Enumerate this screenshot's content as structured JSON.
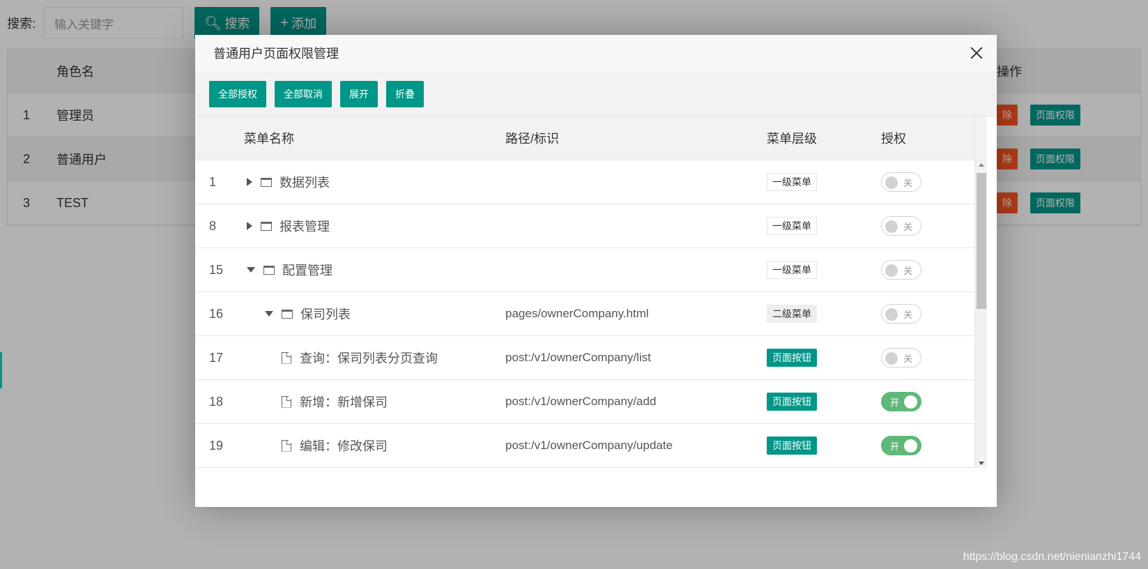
{
  "background": {
    "search_label": "搜索:",
    "search_placeholder": "输入关键字",
    "search_button": "搜索",
    "add_button": "添加",
    "table": {
      "headers": {
        "name": "角色名",
        "op": "操作"
      },
      "rows": [
        {
          "num": "1",
          "name": "管理员",
          "del": "除",
          "perm": "页面权限"
        },
        {
          "num": "2",
          "name": "普通用户",
          "del": "除",
          "perm": "页面权限"
        },
        {
          "num": "3",
          "name": "TEST",
          "del": "除",
          "perm": "页面权限"
        }
      ]
    },
    "watermark": "https://blog.csdn.net/nienianzhi1744"
  },
  "modal": {
    "title": "普通用户页面权限管理",
    "toolbar": {
      "grant_all": "全部授权",
      "cancel_all": "全部取消",
      "expand": "展开",
      "collapse": "折叠"
    },
    "headers": {
      "name": "菜单名称",
      "path": "路径/标识",
      "level": "菜单层级",
      "auth": "授权"
    },
    "rows": [
      {
        "num": "1",
        "name": "数据列表",
        "path": "",
        "level": "一级菜单",
        "auth": "关"
      },
      {
        "num": "8",
        "name": "报表管理",
        "path": "",
        "level": "一级菜单",
        "auth": "关"
      },
      {
        "num": "15",
        "name": "配置管理",
        "path": "",
        "level": "一级菜单",
        "auth": "关"
      },
      {
        "num": "16",
        "name": "保司列表",
        "path": "pages/ownerCompany.html",
        "level": "二级菜单",
        "auth": "关"
      },
      {
        "num": "17",
        "name": "查询：保司列表分页查询",
        "path": "post:/v1/ownerCompany/list",
        "level": "页面按钮",
        "auth": "关"
      },
      {
        "num": "18",
        "name": "新增：新增保司",
        "path": "post:/v1/ownerCompany/add",
        "level": "页面按钮",
        "auth": "开"
      },
      {
        "num": "19",
        "name": "编辑：修改保司",
        "path": "post:/v1/ownerCompany/update",
        "level": "页面按钮",
        "auth": "开"
      }
    ]
  },
  "colors": {
    "primary": "#009688",
    "danger": "#FF5722",
    "switch_on": "#5FB878"
  }
}
